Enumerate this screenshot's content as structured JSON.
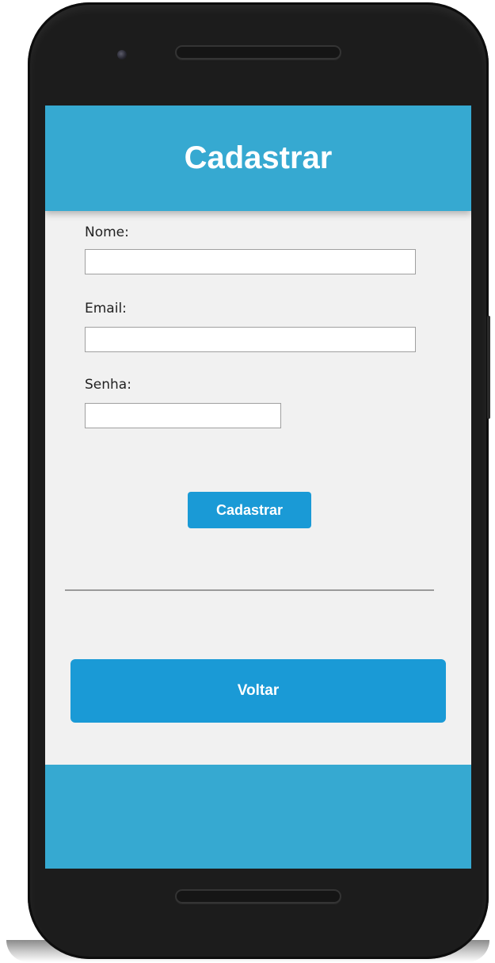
{
  "header": {
    "title": "Cadastrar"
  },
  "form": {
    "name_label": "Nome:",
    "name_value": "",
    "email_label": "Email:",
    "email_value": "",
    "password_label": "Senha:",
    "password_value": "",
    "submit_label": "Cadastrar"
  },
  "actions": {
    "back_label": "Voltar"
  },
  "colors": {
    "header_bg": "#36a9d1",
    "button_bg": "#1a9ad6",
    "screen_bg": "#f1f1f1",
    "phone_body": "#1c1c1c"
  }
}
